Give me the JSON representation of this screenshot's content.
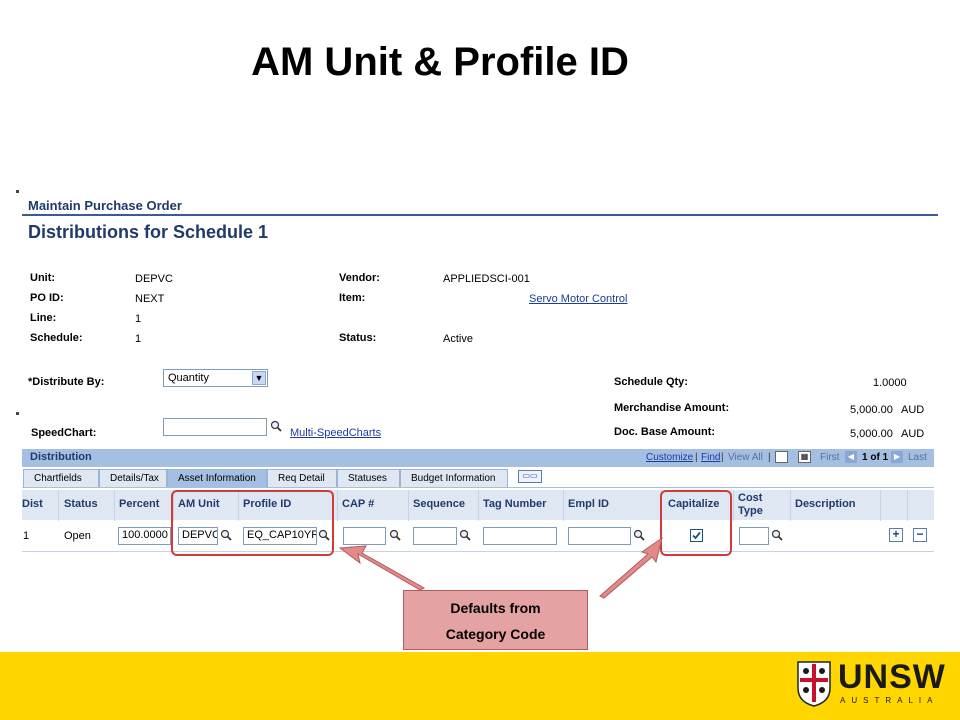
{
  "slide": {
    "title": "AM Unit & Profile ID"
  },
  "page": {
    "header": "Maintain Purchase Order",
    "subheader": "Distributions for Schedule 1"
  },
  "fields": {
    "unit_label": "Unit:",
    "unit_value": "DEPVC",
    "poid_label": "PO ID:",
    "poid_value": "NEXT",
    "line_label": "Line:",
    "line_value": "1",
    "schedule_label": "Schedule:",
    "schedule_value": "1",
    "vendor_label": "Vendor:",
    "vendor_value": "APPLIEDSCI-001",
    "item_label": "Item:",
    "item_value": "Servo Motor Control",
    "status_label": "Status:",
    "status_value": "Active",
    "distribute_by_label": "*Distribute By:",
    "distribute_by_value": "Quantity",
    "speedchart_label": "SpeedChart:",
    "speedchart_value": "",
    "multi_speedcharts_link": "Multi-SpeedCharts",
    "schedule_qty_label": "Schedule Qty:",
    "schedule_qty_value": "1.0000",
    "merch_amount_label": "Merchandise Amount:",
    "merch_amount_value": "5,000.00",
    "merch_currency": "AUD",
    "doc_base_label": "Doc. Base Amount:",
    "doc_base_value": "5,000.00",
    "doc_base_currency": "AUD"
  },
  "grid": {
    "title": "Distribution",
    "nav": {
      "customize": "Customize",
      "sep1": "|",
      "find": "Find",
      "sep2": "|",
      "view_all": "View All",
      "sep3": "|",
      "first": "First",
      "count": "1 of 1",
      "last": "Last"
    },
    "tabs": [
      "Chartfields",
      "Details/Tax",
      "Asset Information",
      "Req Detail",
      "Statuses",
      "Budget Information"
    ],
    "active_tab": "Asset Information",
    "columns": [
      "Dist",
      "Status",
      "Percent",
      "AM Unit",
      "Profile ID",
      "CAP #",
      "Sequence",
      "Tag Number",
      "Empl ID",
      "Capitalize",
      "Cost Type",
      "Description"
    ],
    "row": {
      "dist": "1",
      "status": "Open",
      "percent": "100.0000",
      "am_unit": "DEPVC",
      "profile_id": "EQ_CAP10YR",
      "cap": "",
      "sequence": "",
      "tag": "",
      "emplid": "",
      "capitalize": true,
      "cost_type": ""
    }
  },
  "callout": {
    "line1": "Defaults from",
    "line2": "Category Code"
  },
  "footer": {
    "logo": "UNSW",
    "logo_sub": "AUSTRALIA"
  },
  "colors": {
    "accent": "#1f3a6b",
    "footer": "#ffd600",
    "highlight": "#d33a3a",
    "callout": "#e4a2a2"
  }
}
